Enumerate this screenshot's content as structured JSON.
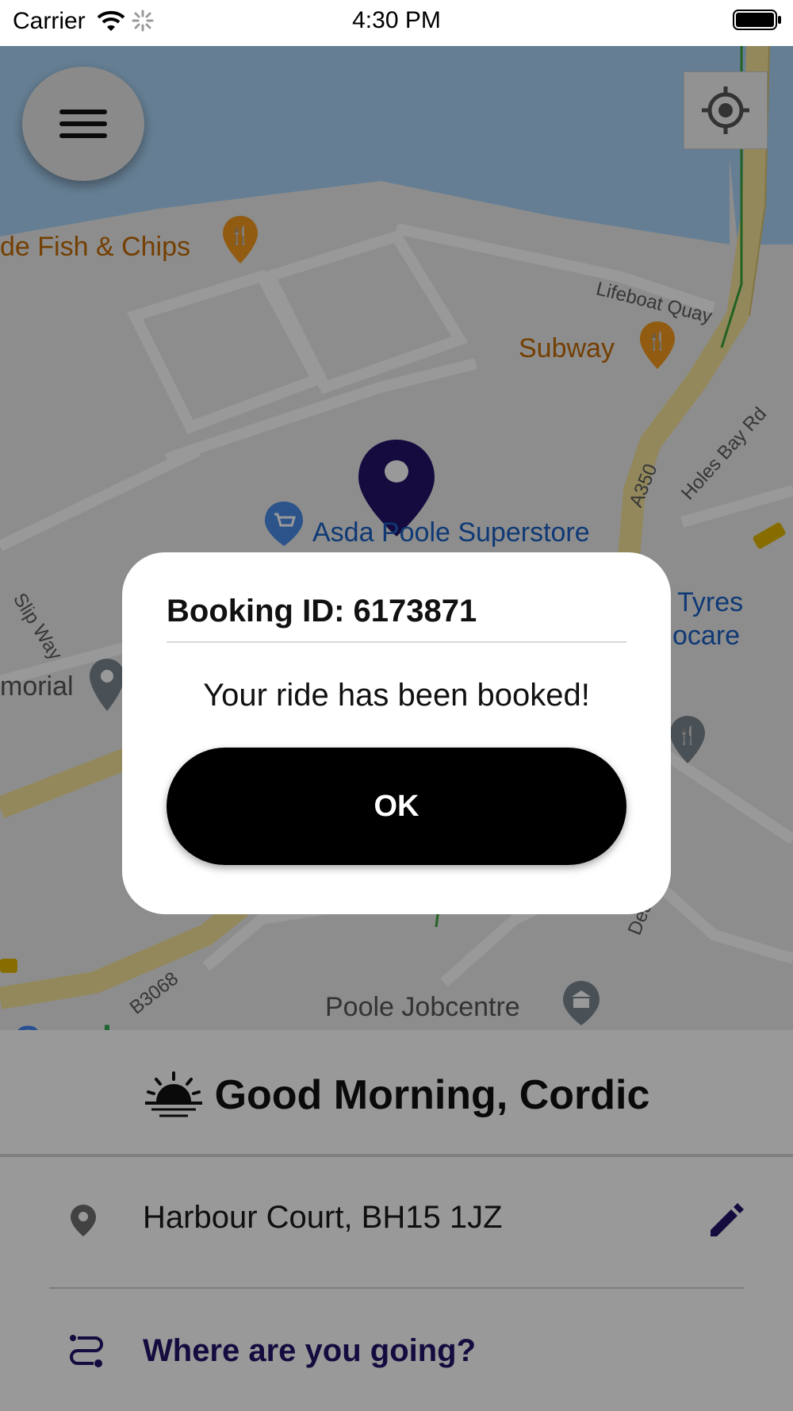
{
  "status_bar": {
    "carrier": "Carrier",
    "time": "4:30 PM"
  },
  "map": {
    "pois": {
      "fish_chips": "de Fish & Chips",
      "subway": "Subway",
      "asda": "Asda Poole Superstore",
      "tyres_1": "Tyres",
      "tyres_2": "ocare",
      "memorial": "morial",
      "jobcentre": "Poole Jobcentre"
    },
    "roads": {
      "lifeboat_quay": "Lifeboat Quay",
      "holes_bay": "Holes Bay Rd",
      "a350": "A350",
      "slip_way": "Slip Way",
      "b3068": "B3068",
      "dear_hay": "Dear H"
    },
    "google_logo": "Google",
    "colors": {
      "water": "#a9d3f5",
      "land": "#ebebeb",
      "road_major": "#f5e39a",
      "pin": "#24136a"
    }
  },
  "dialog": {
    "title": "Booking ID: 6173871",
    "message": "Your ride has been booked!",
    "ok_label": "OK"
  },
  "sheet": {
    "greeting": "Good Morning, Cordic",
    "pickup": "Harbour Court, BH15 1JZ",
    "destination_prompt": "Where are you going?"
  },
  "icons": [
    "menu-icon",
    "locate-icon",
    "map-pin-icon",
    "sunrise-icon",
    "location-icon",
    "edit-icon",
    "route-icon",
    "wifi-icon",
    "battery-icon"
  ]
}
